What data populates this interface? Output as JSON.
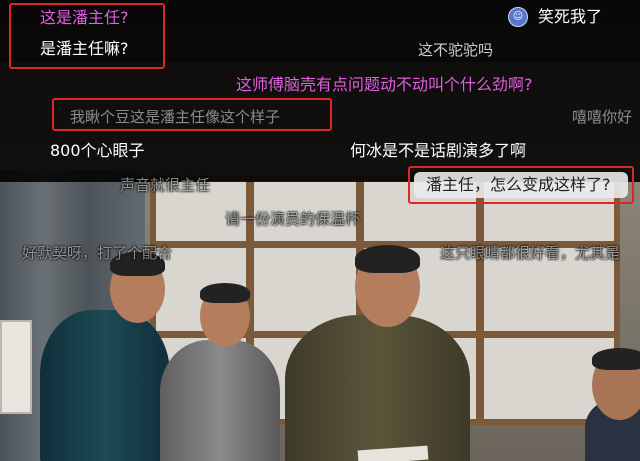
{
  "danmaku": {
    "line1": "这是潘主任?",
    "line2": "是潘主任嘛?",
    "laugh": "笑死我了",
    "not_camel": "这不驼驼吗",
    "purple_q": "这师傅脑壳有点问题动不动叫个什么劲啊?",
    "line4": "我瞅个豆这是潘主任像这个样子",
    "right_cut": "嘻嘻你好",
    "xinyan": "800个心眼子",
    "hebing": "何冰是不是话剧演多了啊",
    "voice": "声音就很主任",
    "pan_change": "潘主任，怎么变成这样了?",
    "teacher": "请一份演员的保温杯",
    "funny": "好默契呀，打了个配合",
    "right_long": "这只眼睛都很好看，尤其是"
  },
  "colors": {
    "highlight_box": "#e0252a",
    "purple_text": "#e05fe0",
    "overlay": "#000000"
  },
  "icons": {
    "user_avatar": "avatar-icon"
  }
}
